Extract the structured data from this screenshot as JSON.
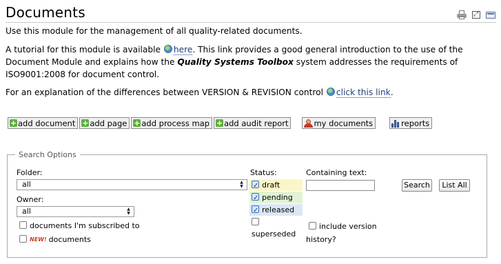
{
  "page": {
    "title": "Documents"
  },
  "tools": {
    "print_icon": "printer-icon",
    "expand_icon": "expand-icon",
    "email_icon": "email-icon"
  },
  "intro": {
    "line1": "Use this module for the management of all quality-related documents.",
    "tutorial_pre": "A tutorial for this module is available ",
    "tutorial_link": "here",
    "tutorial_mid": ". This link provides a good general introduction to the use of the Document Module and explains how the ",
    "product_name": "Quality Systems Toolbox",
    "tutorial_post": " system addresses the requirements of ISO9001:2008 for document control.",
    "version_pre": "For an explanation of the differences between VERSION & REVISION control ",
    "version_link": "click this link",
    "version_post": "."
  },
  "actions": {
    "add_document": "add document",
    "add_page": "add page",
    "add_process_map": "add process map",
    "add_audit_report": "add audit report",
    "my_documents": "my documents",
    "reports": "reports"
  },
  "search": {
    "legend": "Search Options",
    "folder_label": "Folder:",
    "folder_value": "all",
    "owner_label": "Owner:",
    "owner_value": "all",
    "subscribed_label": "documents I'm subscribed to",
    "new_badge": "NEW!",
    "new_documents_label": "documents",
    "status_label": "Status:",
    "statuses": [
      {
        "label": "draft",
        "checked": true,
        "color": "#fbf6c8"
      },
      {
        "label": "pending",
        "checked": true,
        "color": "#e1f3d4"
      },
      {
        "label": "released",
        "checked": true,
        "color": "#dbe7f6"
      },
      {
        "label": "superseded",
        "checked": false
      }
    ],
    "containing_label": "Containing text:",
    "containing_value": "",
    "include_version_label": "include version",
    "history_label": "history?",
    "search_button": "Search",
    "list_all_button": "List All"
  }
}
